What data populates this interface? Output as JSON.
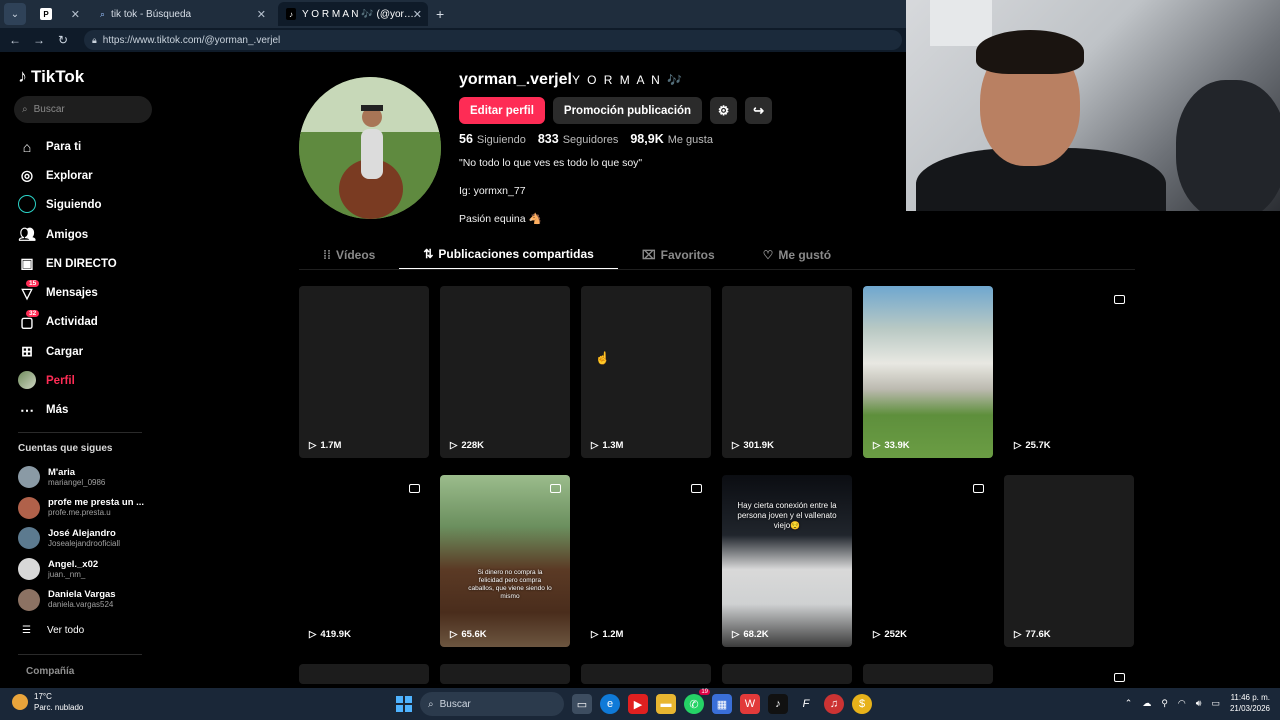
{
  "browser": {
    "tabs": [
      {
        "label": "",
        "favicon": "P",
        "active": false
      },
      {
        "label": "tik tok - Búsqueda",
        "favicon": "search",
        "active": false
      },
      {
        "label": "Y O R M A N 🎶 (@yorman_.verjel)",
        "favicon": "tiktok",
        "active": true
      }
    ],
    "new_tab": "+",
    "url": "https://www.tiktok.com/@yorman_.verjel"
  },
  "sidebar": {
    "brand": "TikTok",
    "search_placeholder": "Buscar",
    "nav": [
      {
        "label": "Para ti",
        "icon": "home-icon"
      },
      {
        "label": "Explorar",
        "icon": "compass-icon"
      },
      {
        "label": "Siguiendo",
        "icon": "following-icon"
      },
      {
        "label": "Amigos",
        "icon": "friends-icon"
      },
      {
        "label": "EN DIRECTO",
        "icon": "live-icon"
      },
      {
        "label": "Mensajes",
        "icon": "messages-icon",
        "badge": "15"
      },
      {
        "label": "Actividad",
        "icon": "activity-icon",
        "badge": "32"
      },
      {
        "label": "Cargar",
        "icon": "upload-icon"
      },
      {
        "label": "Perfil",
        "icon": "profile-avatar-icon",
        "active": true
      },
      {
        "label": "Más",
        "icon": "more-icon"
      }
    ],
    "following_title": "Cuentas que sigues",
    "following": [
      {
        "name": "M'aria",
        "user": "mariangel_0986"
      },
      {
        "name": "profe me presta un ...",
        "user": "profe.me.presta.u"
      },
      {
        "name": "José Alejandro",
        "user": "Josealejandrooficiall"
      },
      {
        "name": "Angel._x02",
        "user": "juan._nm_"
      },
      {
        "name": "Daniela Vargas",
        "user": "daniela.vargas524"
      }
    ],
    "see_all": "Ver todo",
    "company": "Compañía"
  },
  "profile": {
    "username": "yorman_.verjel",
    "nickname": "Y O R M A N 🎶",
    "edit_button": "Editar perfil",
    "promote_button": "Promoción publicación",
    "following_count": "56",
    "following_label": "Siguiendo",
    "followers_count": "833",
    "followers_label": "Seguidores",
    "likes_count": "98,9K",
    "likes_label": "Me gusta",
    "bio": [
      "\"No todo lo que ves es todo lo que soy\"",
      "Ig: yormxn_77",
      "Pasión equina 🐴"
    ]
  },
  "tabs": [
    {
      "label": "Vídeos",
      "icon": "grid-icon",
      "active": false
    },
    {
      "label": "Publicaciones compartidas",
      "icon": "repost-icon",
      "active": true
    },
    {
      "label": "Favoritos",
      "icon": "bookmark-icon",
      "active": false
    },
    {
      "label": "Me gustó",
      "icon": "heart-icon",
      "active": false
    }
  ],
  "posts": [
    {
      "views": "1.7M",
      "style": "dark",
      "photo": false
    },
    {
      "views": "228K",
      "style": "dark",
      "photo": false
    },
    {
      "views": "1.3M",
      "style": "dark",
      "photo": false
    },
    {
      "views": "301.9K",
      "style": "dark",
      "photo": false
    },
    {
      "views": "33.9K",
      "style": "car",
      "photo": false
    },
    {
      "views": "25.7K",
      "style": "black",
      "photo": true
    },
    {
      "views": "419.9K",
      "style": "black",
      "photo": true
    },
    {
      "views": "65.6K",
      "style": "horse",
      "photo": true,
      "caption": "Si dinero no compra la felicidad pero compra caballos, que viene siendo lo mismo"
    },
    {
      "views": "1.2M",
      "style": "black",
      "photo": true
    },
    {
      "views": "68.2K",
      "style": "truck",
      "photo": false,
      "caption": "Hay cierta conexión entre la persona joven y el vallenato viejo😌"
    },
    {
      "views": "252K",
      "style": "black",
      "photo": true
    },
    {
      "views": "77.6K",
      "style": "dark",
      "photo": false
    }
  ],
  "taskbar": {
    "temperature": "17°C",
    "weather": "Parc. nublado",
    "search": "Buscar",
    "time": "11:46 p. m.",
    "date": "21/03/2026",
    "badge": "19"
  }
}
